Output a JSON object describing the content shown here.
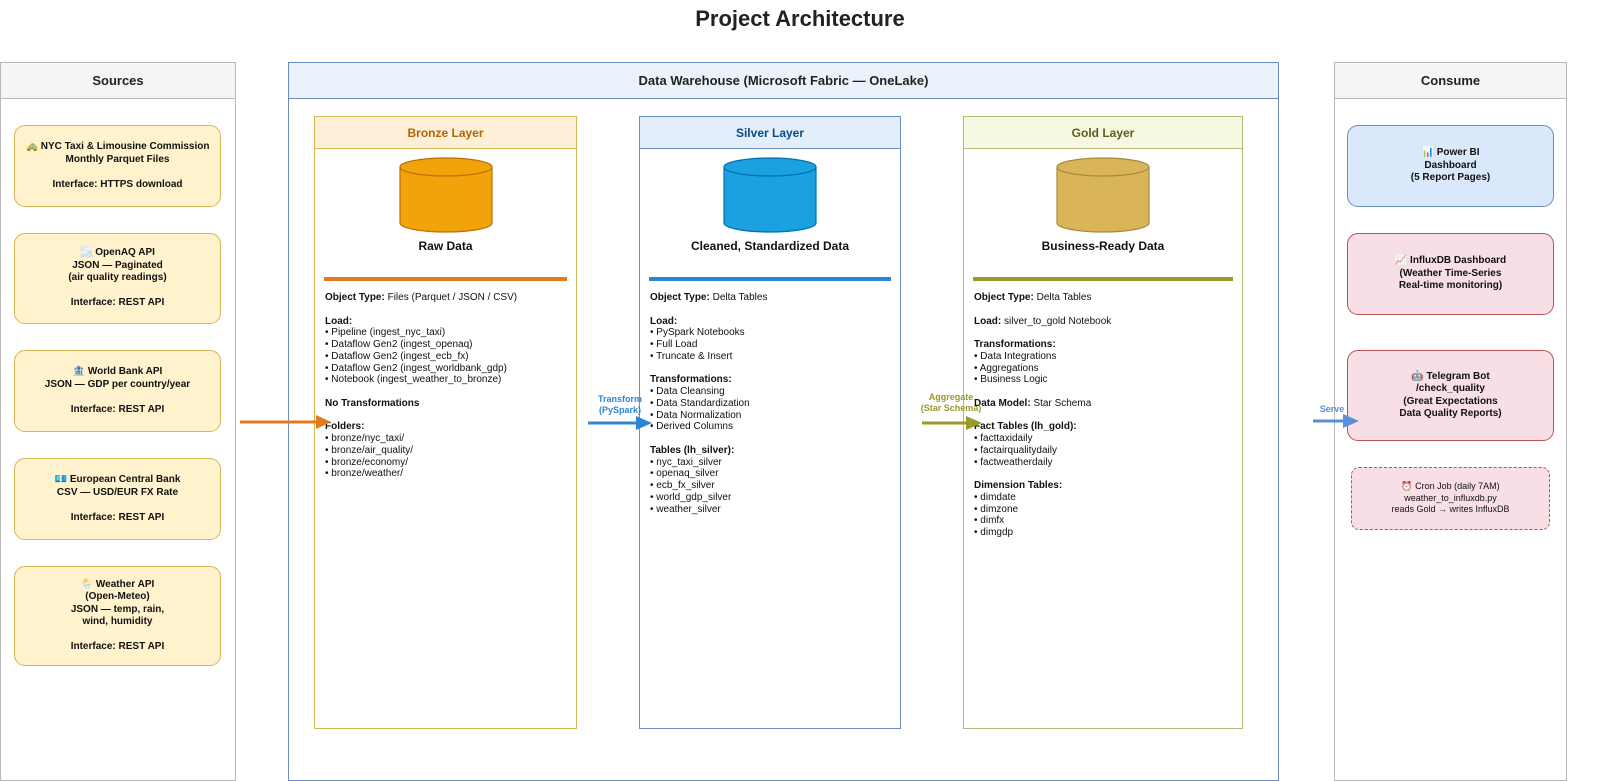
{
  "title": "Project Architecture",
  "panels": {
    "sources": "Sources",
    "warehouse": "Data Warehouse (Microsoft Fabric — OneLake)",
    "consume": "Consume"
  },
  "sources": [
    {
      "icon": "🚕",
      "text": "NYC Taxi & Limousine Commission\nMonthly Parquet Files\n\nInterface: HTTPS download"
    },
    {
      "icon": "🌫️",
      "text": "OpenAQ API\nJSON — Paginated\n(air quality readings)\n\nInterface: REST API"
    },
    {
      "icon": "🏦",
      "text": "World Bank API\nJSON — GDP per country/year\n\nInterface: REST API"
    },
    {
      "icon": "💶",
      "text": "European Central Bank\nCSV — USD/EUR FX Rate\n\nInterface: REST API"
    },
    {
      "icon": "🌦️",
      "text": "Weather API\n(Open-Meteo)\nJSON — temp, rain,\nwind, humidity\n\nInterface: REST API"
    }
  ],
  "layers": {
    "bronze": {
      "title": "Bronze Layer",
      "subtitle": "Raw Data",
      "color": "#f0a30a",
      "bar_color": "#e07b1f",
      "object_type_label": "Object Type:",
      "object_type": " Files (Parquet / JSON / CSV)",
      "load_title": "Load:",
      "load": [
        "Pipeline (ingest_nyc_taxi)",
        "Dataflow Gen2 (ingest_openaq)",
        "Dataflow Gen2 (ingest_ecb_fx)",
        "Dataflow Gen2 (ingest_worldbank_gdp)",
        "Notebook (ingest_weather_to_bronze)"
      ],
      "no_transform": "No Transformations",
      "folders_title": "Folders:",
      "folders": [
        "bronze/nyc_taxi/",
        "bronze/air_quality/",
        "bronze/economy/",
        "bronze/weather/"
      ]
    },
    "silver": {
      "title": "Silver Layer",
      "subtitle": "Cleaned, Standardized Data",
      "color": "#1ba1e2",
      "bar_color": "#2a87d7",
      "object_type_label": "Object Type:",
      "object_type": " Delta Tables",
      "load_title": "Load:",
      "load": [
        "PySpark Notebooks",
        "Full Load",
        "Truncate & Insert"
      ],
      "transform_title": "Transformations:",
      "transform": [
        "Data Cleansing",
        "Data Standardization",
        "Data Normalization",
        "Derived Columns"
      ],
      "tables_title": "Tables (lh_silver):",
      "tables": [
        "nyc_taxi_silver",
        "openaq_silver",
        "ecb_fx_silver",
        "world_gdp_silver",
        "weather_silver"
      ]
    },
    "gold": {
      "title": "Gold Layer",
      "subtitle": "Business-Ready Data",
      "color": "#d9b458",
      "bar_color": "#999a2a",
      "object_type_label": "Object Type:",
      "object_type": " Delta Tables",
      "load_label": "Load:",
      "load": " silver_to_gold Notebook",
      "transform_title": "Transformations:",
      "transform": [
        "Data Integrations",
        "Aggregations",
        "Business Logic"
      ],
      "model_label": "Data Model:",
      "model": " Star Schema",
      "fact_title": "Fact Tables (lh_gold):",
      "fact": [
        "facttaxidaily",
        "factairqualitydaily",
        "factweatherdaily"
      ],
      "dim_title": "Dimension Tables:",
      "dim": [
        "dimdate",
        "dimzone",
        "dimfx",
        "dimgdp"
      ]
    }
  },
  "flows": {
    "transform": "Transform\n(PySpark)",
    "aggregate": "Aggregate\n(Star Schema)",
    "serve": "Serve",
    "colors": {
      "ingest": "#e07b1f",
      "transform": "#2a87d7",
      "aggregate": "#999a2a",
      "serve": "#5b8fd9"
    }
  },
  "consume": [
    {
      "icon": "📊",
      "text": "Power BI\nDashboard\n(5 Report Pages)"
    },
    {
      "icon": "📈",
      "text": "InfluxDB Dashboard\n(Weather Time-Series\nReal-time monitoring)"
    },
    {
      "icon": "🤖",
      "text": "Telegram Bot\n/check_quality\n(Great Expectations\nData Quality Reports)"
    },
    {
      "icon": "⏰",
      "text": "Cron Job (daily 7AM)\nweather_to_influxdb.py\nreads Gold → writes InfluxDB"
    }
  ]
}
